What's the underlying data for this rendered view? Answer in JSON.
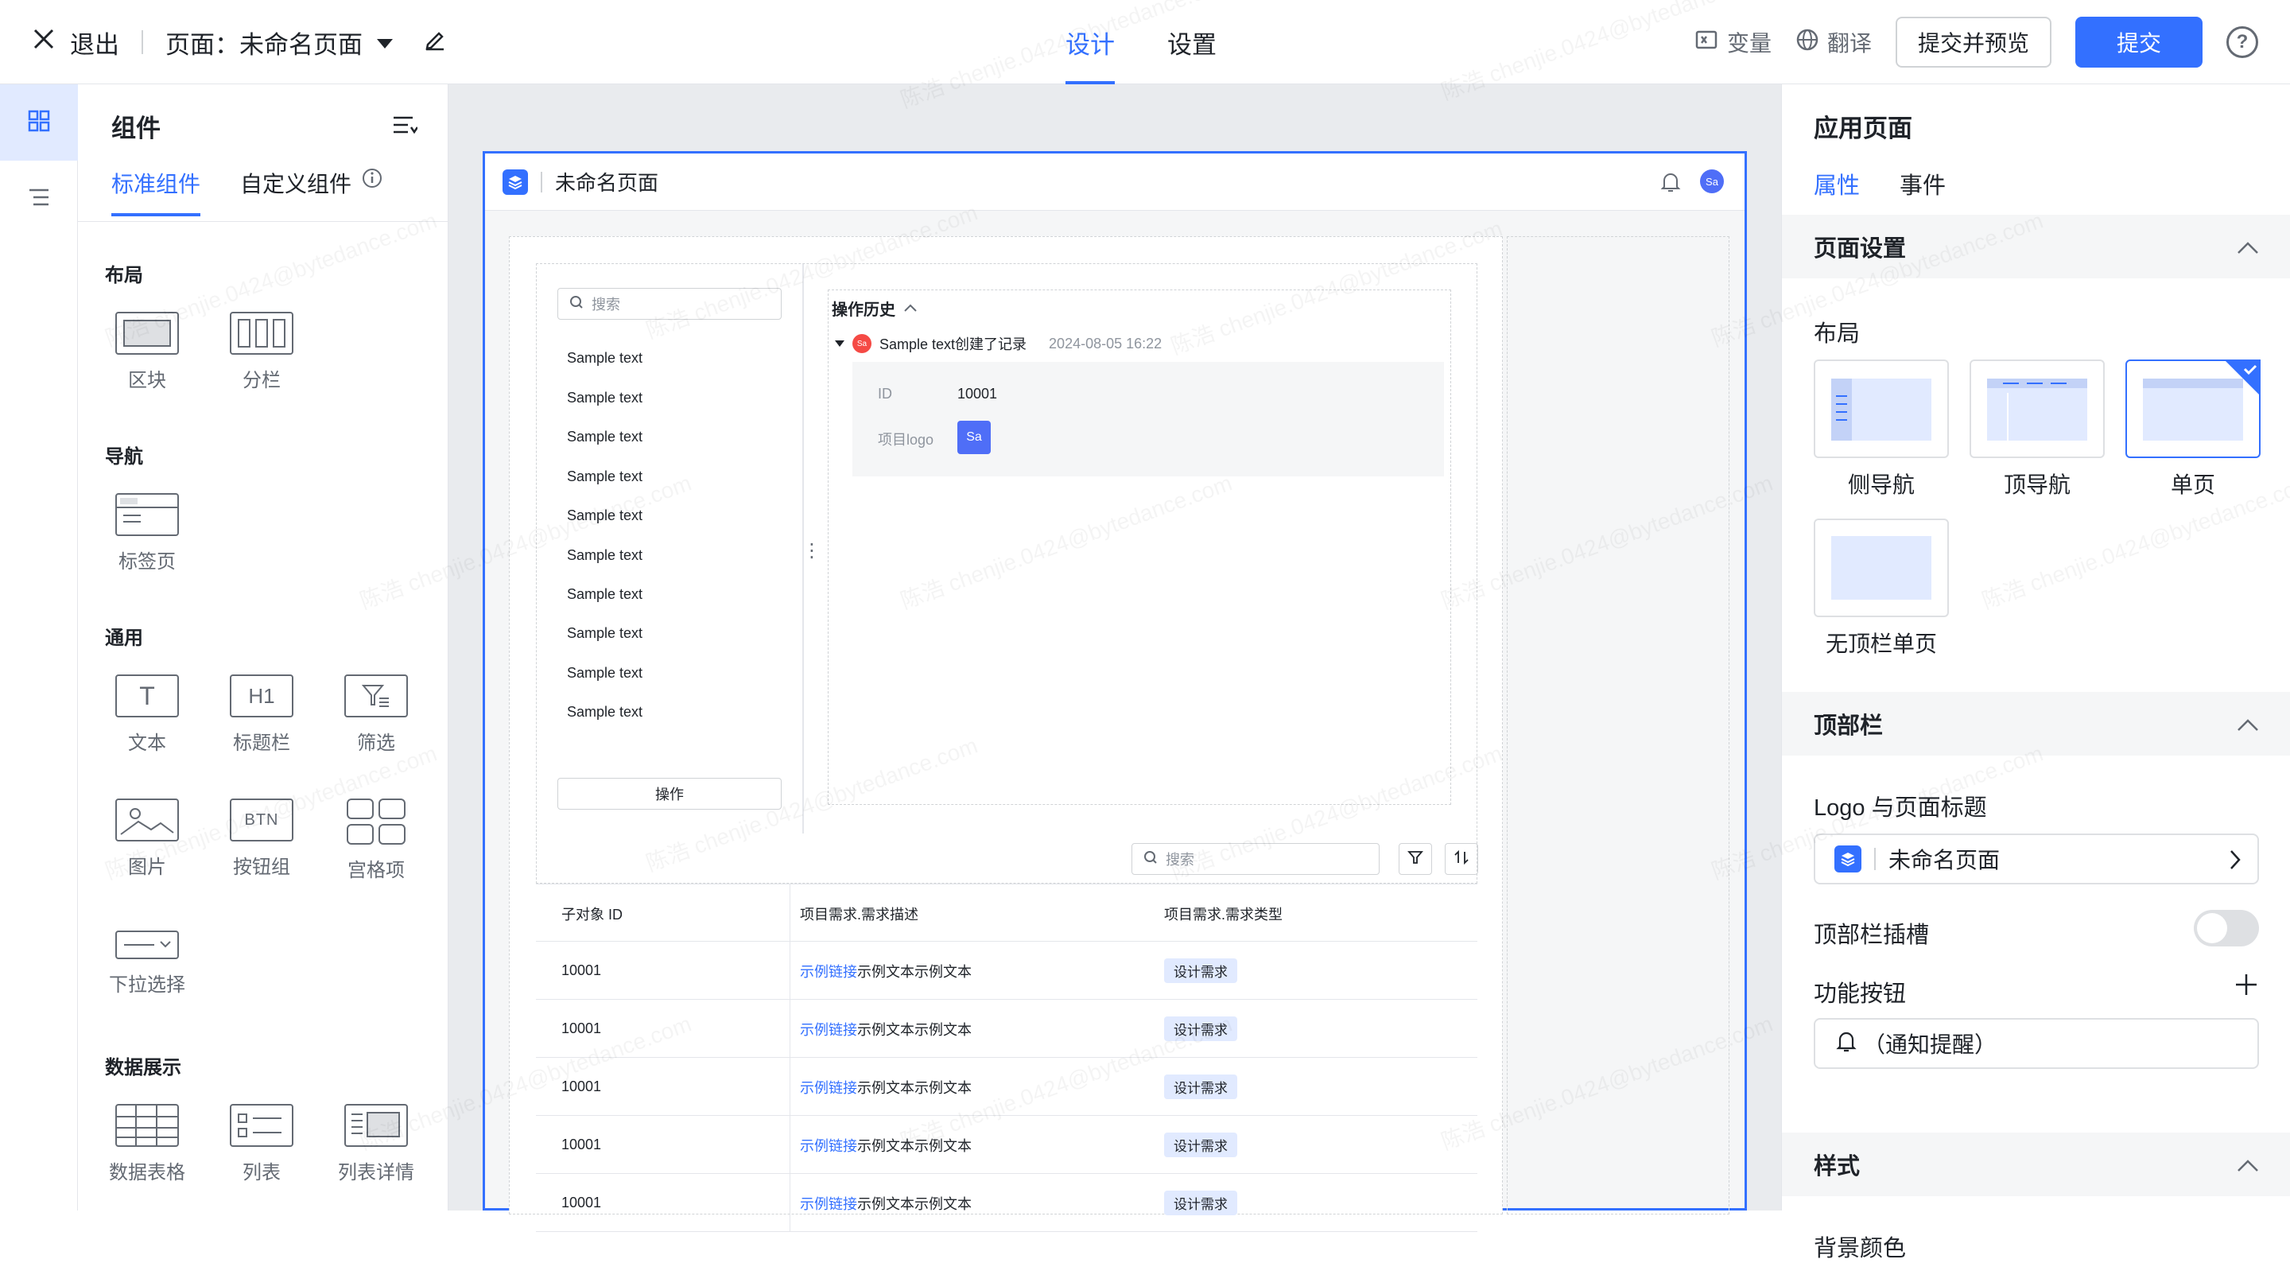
{
  "topbar": {
    "exit_label": "退出",
    "page_label": "页面：未命名页面",
    "tabs": [
      "设计",
      "设置"
    ],
    "variable_label": "变量",
    "translate_label": "翻译",
    "submit_preview_label": "提交并预览",
    "submit_label": "提交"
  },
  "left_panel": {
    "title": "组件",
    "tabs": [
      "标准组件",
      "自定义组件"
    ],
    "sections": {
      "layout": "布局",
      "nav": "导航",
      "common": "通用",
      "data": "数据展示"
    },
    "components": {
      "block": "区块",
      "columns": "分栏",
      "tabs": "标签页",
      "text": "文本",
      "title_bar": "标题栏",
      "filter": "筛选",
      "image": "图片",
      "button_group": "按钮组",
      "grid": "宫格项",
      "dropdown": "下拉选择",
      "data_table": "数据表格",
      "list": "列表",
      "list_detail": "列表详情"
    },
    "icon_text": {
      "heading": "H1",
      "button": "BTN"
    }
  },
  "canvas": {
    "page_title": "未命名页面",
    "avatar": "Sa",
    "search_placeholder": "搜索",
    "list_items": [
      "Sample text",
      "Sample text",
      "Sample text",
      "Sample text",
      "Sample text",
      "Sample text",
      "Sample text",
      "Sample text",
      "Sample text",
      "Sample text"
    ],
    "op_button": "操作",
    "history": {
      "title": "操作历史",
      "entry_text": "Sample text创建了记录",
      "entry_avatar": "Sa",
      "entry_time": "2024-08-05 16:22",
      "id_key": "ID",
      "id_value": "10001",
      "logo_key": "项目logo",
      "logo_value": "Sa"
    },
    "table": {
      "search_placeholder": "搜索",
      "headers": [
        "子对象 ID",
        "项目需求.需求描述",
        "项目需求.需求类型"
      ],
      "rows": [
        {
          "id": "10001",
          "link": "示例链接",
          "text": "示例文本示例文本",
          "tag": "设计需求"
        },
        {
          "id": "10001",
          "link": "示例链接",
          "text": "示例文本示例文本",
          "tag": "设计需求"
        },
        {
          "id": "10001",
          "link": "示例链接",
          "text": "示例文本示例文本",
          "tag": "设计需求"
        },
        {
          "id": "10001",
          "link": "示例链接",
          "text": "示例文本示例文本",
          "tag": "设计需求"
        },
        {
          "id": "10001",
          "link": "示例链接",
          "text": "示例文本示例文本",
          "tag": "设计需求"
        }
      ]
    }
  },
  "right_panel": {
    "title": "应用页面",
    "tabs": [
      "属性",
      "事件"
    ],
    "page_settings": "页面设置",
    "layout_label": "布局",
    "layouts": [
      "侧导航",
      "顶导航",
      "单页",
      "无顶栏单页"
    ],
    "topbar_section": "顶部栏",
    "logo_title_label": "Logo 与页面标题",
    "logo_title_value": "未命名页面",
    "slot_label": "顶部栏插槽",
    "func_buttons_label": "功能按钮",
    "func_button_value": "（通知提醒）",
    "style_section": "样式",
    "bg_color_label": "背景颜色"
  },
  "watermark": "陈浩 chenjie.0424@bytedance.com",
  "colors": {
    "accent": "#3370ff",
    "tag_bg": "#e1eaff",
    "canvas_bg": "#e9ebee"
  }
}
